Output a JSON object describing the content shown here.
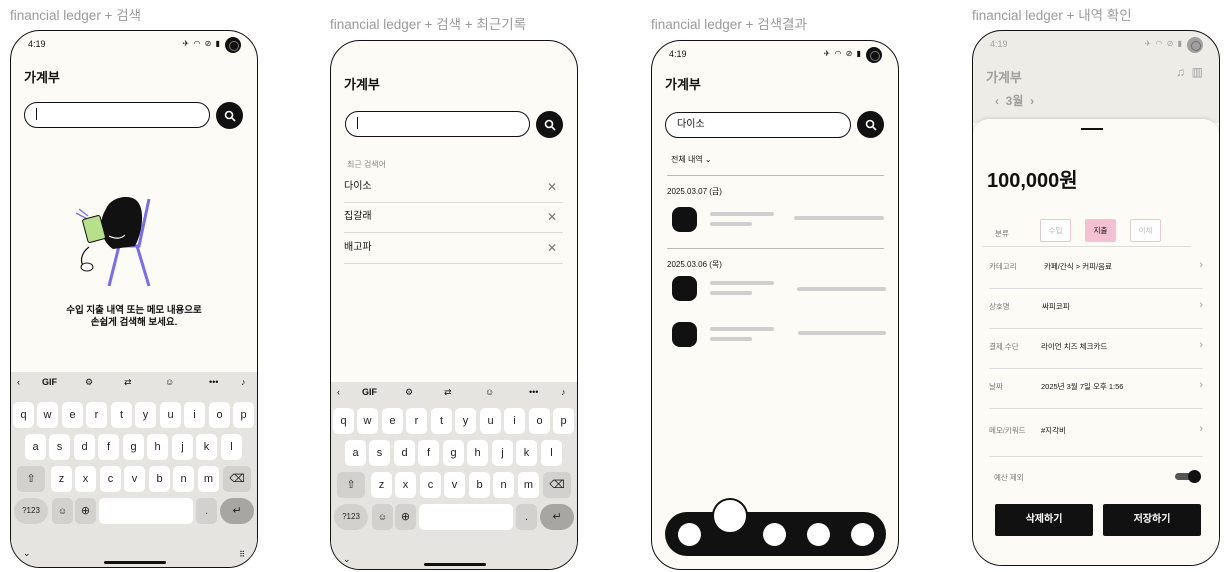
{
  "screens": {
    "s1": {
      "label": "financial ledger + 검색",
      "time": "4:19",
      "title": "가계부",
      "empty_line1": "수입 지출 내역 또는 메모 내용으로",
      "empty_line2": "손쉽게 검색해 보세요."
    },
    "s2": {
      "label": "financial ledger + 검색 + 최근기록",
      "title": "가계부",
      "recent_header": "최근 검색어",
      "recent": [
        "다이소",
        "집갈래",
        "배고파"
      ]
    },
    "s3": {
      "label": "financial ledger + 검색결과",
      "time": "4:19",
      "title": "가계부",
      "query": "다이소",
      "filter": "전체 내역",
      "dates": [
        "2025.03.07 (금)",
        "2025.03.06 (목)"
      ]
    },
    "s4": {
      "label": "financial ledger + 내역 확인",
      "time": "4:19",
      "title": "가계부",
      "month": "3월",
      "amount": "100,000원",
      "type_label": "분류",
      "types": [
        "수입",
        "지출",
        "이체"
      ],
      "active_type": "지출",
      "rows": [
        {
          "k": "카테고리",
          "v": "카페/간식 > 커피/음료"
        },
        {
          "k": "상호명",
          "v": "싸피코피"
        },
        {
          "k": "결제 수단",
          "v": "라이언 치즈 체크카드"
        },
        {
          "k": "날짜",
          "v": "2025년 3월 7일 오후 1:56"
        },
        {
          "k": "메모/키워드",
          "v": "#지각비"
        }
      ],
      "budget_label": "예산 제외",
      "budget_excluded": true,
      "delete_label": "삭제하기",
      "save_label": "저장하기"
    }
  },
  "keyboard": {
    "gif": "GIF",
    "row1": [
      "q",
      "w",
      "e",
      "r",
      "t",
      "y",
      "u",
      "i",
      "o",
      "p"
    ],
    "row2": [
      "a",
      "s",
      "d",
      "f",
      "g",
      "h",
      "j",
      "k",
      "l"
    ],
    "row3": [
      "z",
      "x",
      "c",
      "v",
      "b",
      "n",
      "m"
    ],
    "num_key": "?123",
    "emoji_key": "☺",
    "comma": ",",
    "period": "."
  },
  "icons": {
    "search": "search-icon",
    "close": "close-icon",
    "bell": "bell-icon",
    "chart": "chart-icon",
    "enter": "enter-icon"
  }
}
